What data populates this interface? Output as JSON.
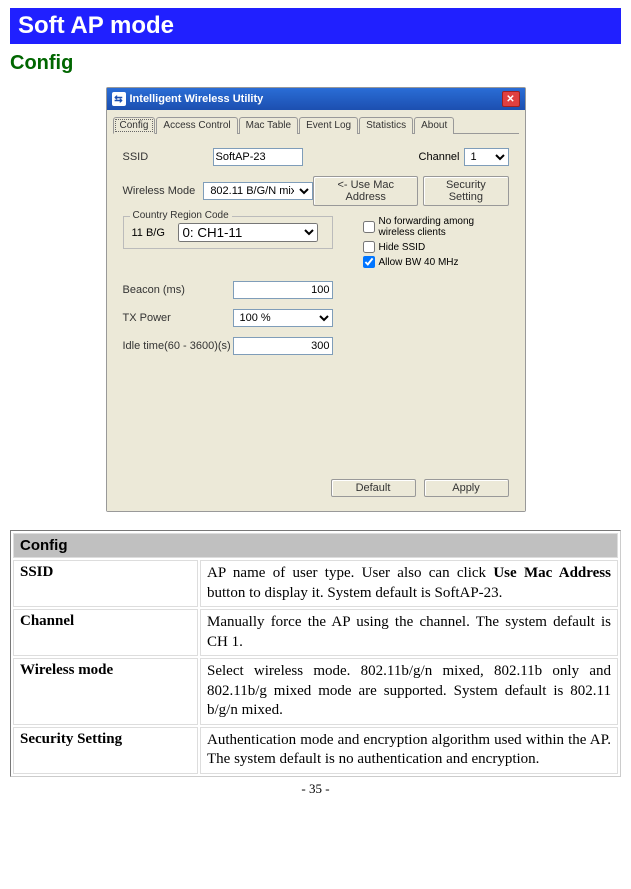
{
  "titleBar": "Soft AP mode",
  "sectionHeading": "Config",
  "window": {
    "title": "Intelligent Wireless Utility",
    "tabs": [
      "Config",
      "Access Control",
      "Mac Table",
      "Event Log",
      "Statistics",
      "About"
    ],
    "activeTab": "Config",
    "ssidLabel": "SSID",
    "ssidValue": "SoftAP-23",
    "channelLabel": "Channel",
    "channelValue": "1",
    "wirelessModeLabel": "Wireless Mode",
    "wirelessModeValue": "802.11 B/G/N mix",
    "useMacBtn": "<- Use Mac Address",
    "securityBtn": "Security Setting",
    "countryRegionLegend": "Country Region Code",
    "bgLabel": "11 B/G",
    "bgValue": "0: CH1-11",
    "checks": {
      "noFwd": {
        "label": "No forwarding among wireless clients",
        "checked": false
      },
      "hideSsid": {
        "label": "Hide SSID",
        "checked": false
      },
      "allowBw": {
        "label": "Allow BW 40 MHz",
        "checked": true
      }
    },
    "beaconLabel": "Beacon (ms)",
    "beaconValue": "100",
    "txPowerLabel": "TX Power",
    "txPowerValue": "100 %",
    "idleLabel": "Idle time(60 - 3600)(s)",
    "idleValue": "300",
    "defaultBtn": "Default",
    "applyBtn": "Apply"
  },
  "configTable": {
    "header": "Config",
    "rows": [
      {
        "label": "SSID",
        "desc_pre": "AP name of user type. User also can click ",
        "desc_bold": "Use Mac Address",
        "desc_post": " button to display it. System default is SoftAP-23."
      },
      {
        "label": "Channel",
        "desc_pre": "Manually force the AP using the channel. The system default is CH 1.",
        "desc_bold": "",
        "desc_post": ""
      },
      {
        "label": "Wireless mode",
        "desc_pre": "Select wireless mode. 802.11b/g/n mixed, 802.11b only and 802.11b/g mixed mode are supported. System default is 802.11 b/g/n mixed.",
        "desc_bold": "",
        "desc_post": ""
      },
      {
        "label": "Security Setting",
        "desc_pre": "Authentication mode and encryption algorithm used within the AP. The system default is no authentication and encryption.",
        "desc_bold": "",
        "desc_post": ""
      }
    ]
  },
  "pageNumber": "- 35 -"
}
